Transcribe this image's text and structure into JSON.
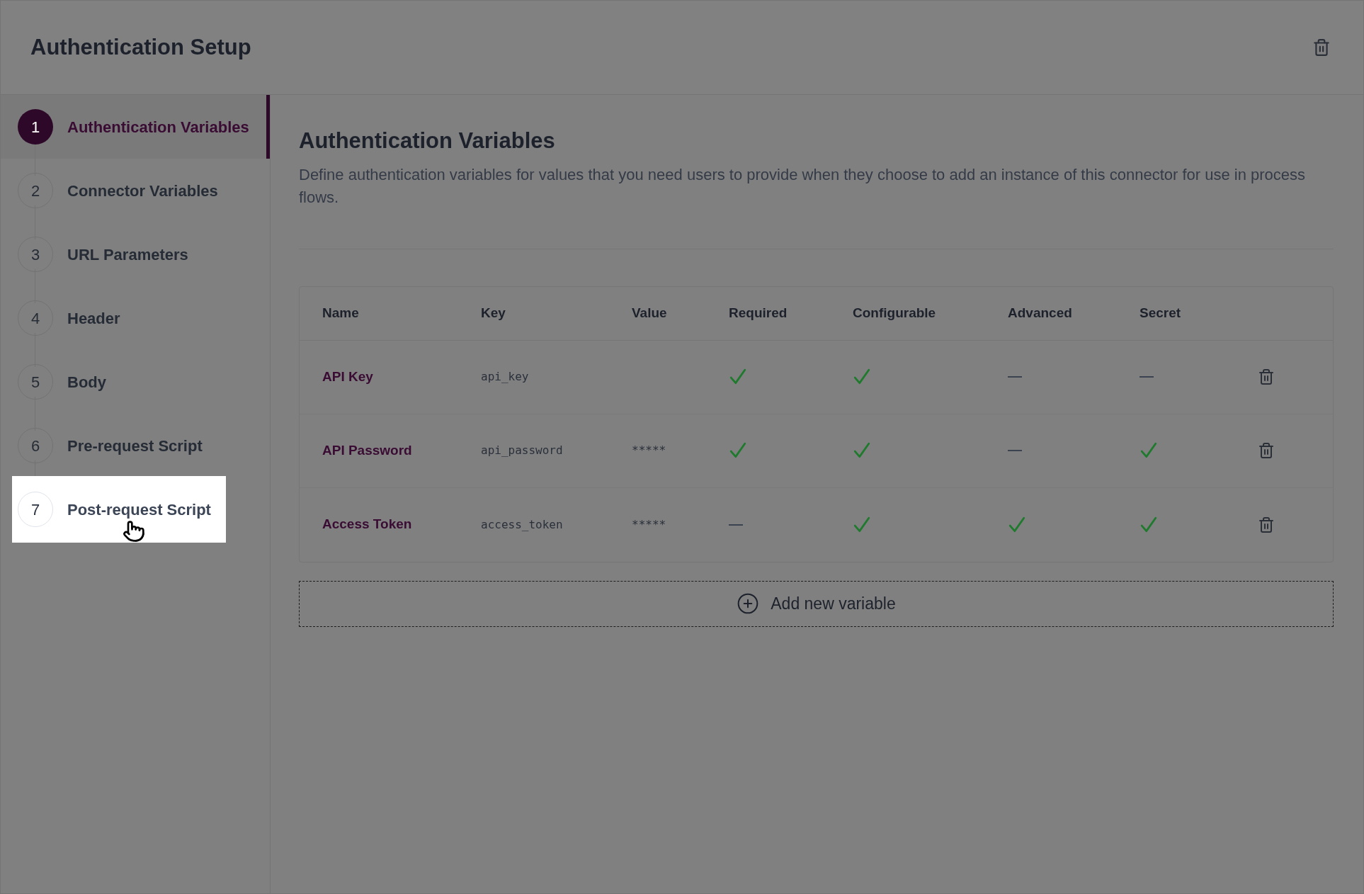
{
  "header": {
    "title": "Authentication Setup"
  },
  "steps": [
    {
      "number": "1",
      "label": "Authentication Variables",
      "selected": true,
      "highlighted": false
    },
    {
      "number": "2",
      "label": "Connector Variables",
      "selected": false,
      "highlighted": false
    },
    {
      "number": "3",
      "label": "URL Parameters",
      "selected": false,
      "highlighted": false
    },
    {
      "number": "4",
      "label": "Header",
      "selected": false,
      "highlighted": false
    },
    {
      "number": "5",
      "label": "Body",
      "selected": false,
      "highlighted": false
    },
    {
      "number": "6",
      "label": "Pre-request Script",
      "selected": false,
      "highlighted": false
    },
    {
      "number": "7",
      "label": "Post-request Script",
      "selected": false,
      "highlighted": true
    }
  ],
  "section": {
    "title": "Authentication Variables",
    "description": "Define authentication variables for values that you need users to provide when they choose to add an instance of this connector for use in process flows."
  },
  "table": {
    "columns": [
      "Name",
      "Key",
      "Value",
      "Required",
      "Configurable",
      "Advanced",
      "Secret"
    ],
    "rows": [
      {
        "name": "API Key",
        "key": "api_key",
        "required": true,
        "configurable": true,
        "advanced": false,
        "secret": false
      },
      {
        "name": "API Password",
        "key": "api_password",
        "value": "*****",
        "required": true,
        "configurable": true,
        "advanced": false,
        "secret": true
      },
      {
        "name": "Access Token",
        "key": "access_token",
        "value": "*****",
        "required": false,
        "configurable": true,
        "advanced": true,
        "secret": true
      }
    ]
  },
  "add_button": {
    "label": "Add new variable"
  }
}
